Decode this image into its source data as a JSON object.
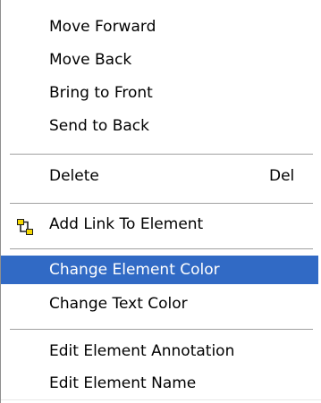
{
  "menu": {
    "group1": [
      {
        "label": "Move Forward"
      },
      {
        "label": "Move Back"
      },
      {
        "label": "Bring to Front"
      },
      {
        "label": "Send to Back"
      }
    ],
    "delete": {
      "label": "Delete",
      "shortcut": "Del"
    },
    "add_link": {
      "label": "Add Link To Element",
      "icon": "link-elements-icon"
    },
    "group3": [
      {
        "label": "Change Element Color",
        "selected": true
      },
      {
        "label": "Change Text Color"
      }
    ],
    "group4": [
      {
        "label": "Edit Element Annotation"
      },
      {
        "label": "Edit Element Name"
      }
    ]
  },
  "colors": {
    "selection": "#316ac5",
    "selection_text": "#ffffff",
    "separator": "#a0a0a0",
    "icon_yellow": "#f5d800",
    "icon_dark": "#202020"
  }
}
